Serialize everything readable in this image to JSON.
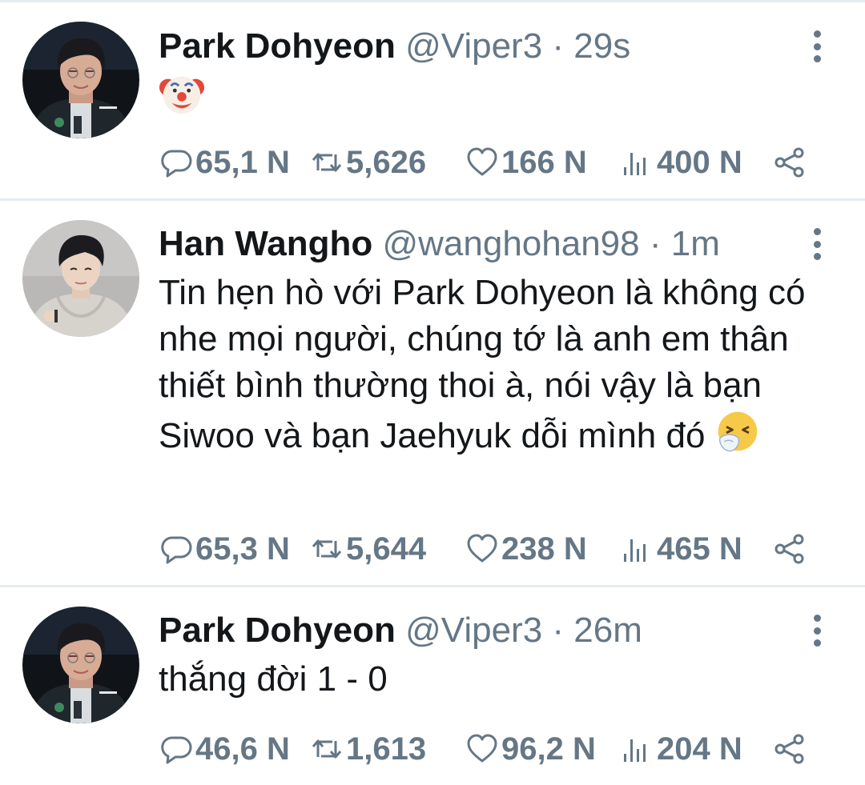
{
  "colors": {
    "text_primary": "#14171a",
    "text_secondary": "#657786",
    "divider": "#e6ecf0"
  },
  "tweets": [
    {
      "name": "Park Dohyeon",
      "handle": "@Viper3",
      "separator": "·",
      "time": "29s",
      "text": "",
      "emoji": "clown-face",
      "stats": {
        "replies": "65,1 N",
        "retweets": "5,626",
        "likes": "166 N",
        "views": "400 N"
      }
    },
    {
      "name": "Han Wangho",
      "handle": "@wanghohan98",
      "separator": "·",
      "time": "1m",
      "text": "Tin hẹn hò với Park Dohyeon là không có nhe mọi người, chúng tớ là anh em thân thiết bình thường thoi à, nói vậy là bạn Siwoo và bạn Jaehyuk dỗi mình đó",
      "emoji": "sneezing-face",
      "stats": {
        "replies": "65,3 N",
        "retweets": "5,644",
        "likes": "238 N",
        "views": "465 N"
      }
    },
    {
      "name": "Park Dohyeon",
      "handle": "@Viper3",
      "separator": "·",
      "time": "26m",
      "text": "thắng đời 1 - 0",
      "emoji": "",
      "stats": {
        "replies": "46,6 N",
        "retweets": "1,613",
        "likes": "96,2 N",
        "views": "204 N"
      }
    }
  ]
}
